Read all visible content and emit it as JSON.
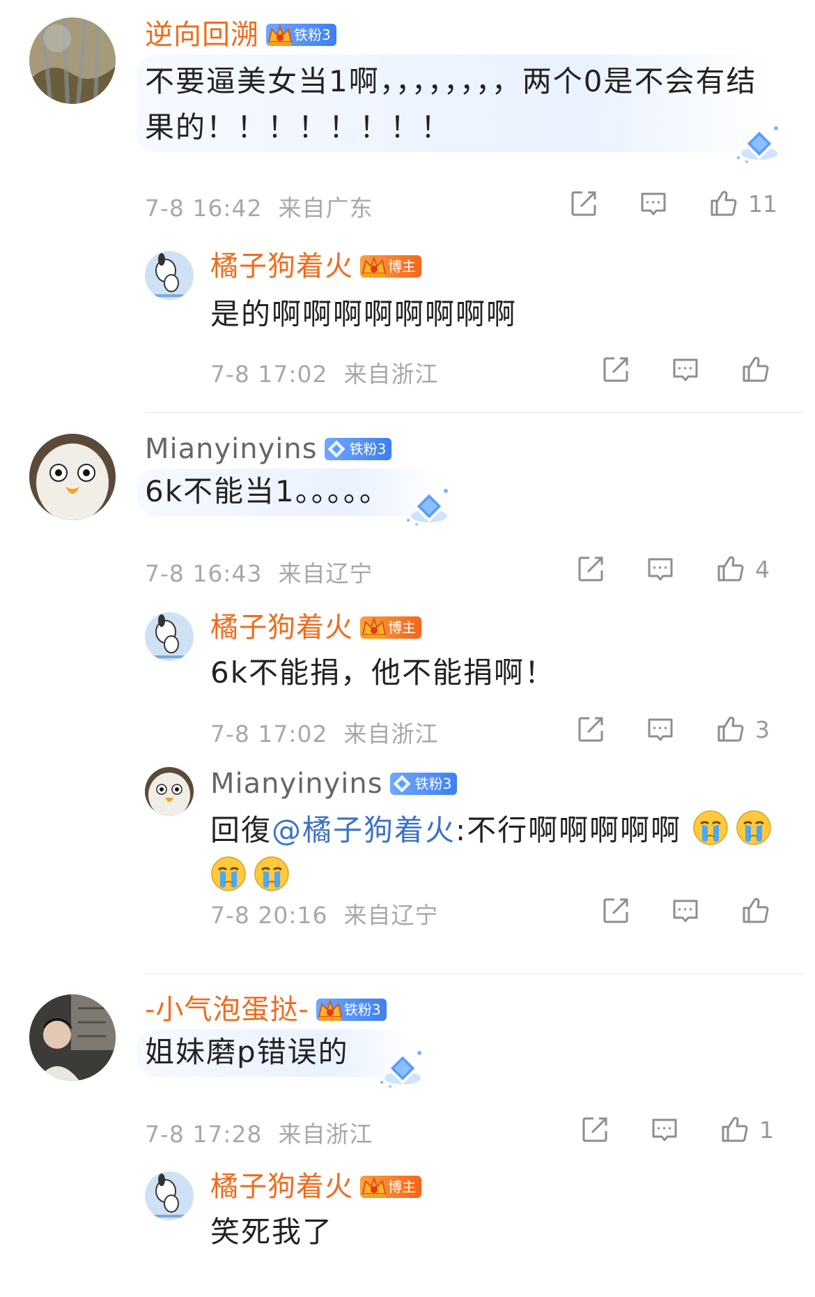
{
  "comments": [
    {
      "name": "逆向回溯",
      "badge": "铁粉3",
      "crown_level": "2",
      "text_line1": "不要逼美女当1啊，，，，，，，，两个0是不会有结",
      "text_line2": "果的！！！！！！！！",
      "time": "7-8 16:42",
      "location": "来自广东",
      "likes": "11",
      "reply": {
        "name": "橘子狗着火",
        "badge": "博主",
        "crown_level": "2",
        "text": "是的啊啊啊啊啊啊啊啊",
        "time": "7-8 17:02",
        "location": "来自浙江",
        "likes": ""
      }
    },
    {
      "name": "Mianyinyins",
      "badge": "铁粉3",
      "text": "6k不能当1。。。。。",
      "time": "7-8 16:43",
      "location": "来自辽宁",
      "likes": "4",
      "reply": {
        "name": "橘子狗着火",
        "badge": "博主",
        "crown_level": "2",
        "text": "6k不能捐，他不能捐啊！",
        "time": "7-8 17:02",
        "location": "来自浙江",
        "likes": "3"
      },
      "reply2": {
        "name": "Mianyinyins",
        "badge": "铁粉3",
        "prefix": "回復",
        "mention": "@橘子狗着火",
        "text": ":不行啊啊啊啊啊",
        "time": "7-8 20:16",
        "location": "来自辽宁",
        "likes": ""
      }
    },
    {
      "name": "-小气泡蛋挞-",
      "badge": "铁粉3",
      "crown_level": "4",
      "text": "姐妹磨p错误的",
      "time": "7-8 17:28",
      "location": "来自浙江",
      "likes": "1",
      "reply": {
        "name": "橘子狗着火",
        "badge": "博主",
        "crown_level": "2",
        "text": "笑死我了"
      }
    }
  ],
  "colors": {
    "orange_name": "#f06b1c",
    "gray_meta": "#a8a8a8",
    "mention": "#3a73c5"
  },
  "icons": [
    "share-icon",
    "comment-icon",
    "like-icon",
    "cry-emoji",
    "crown-icon",
    "diamond-icon"
  ]
}
